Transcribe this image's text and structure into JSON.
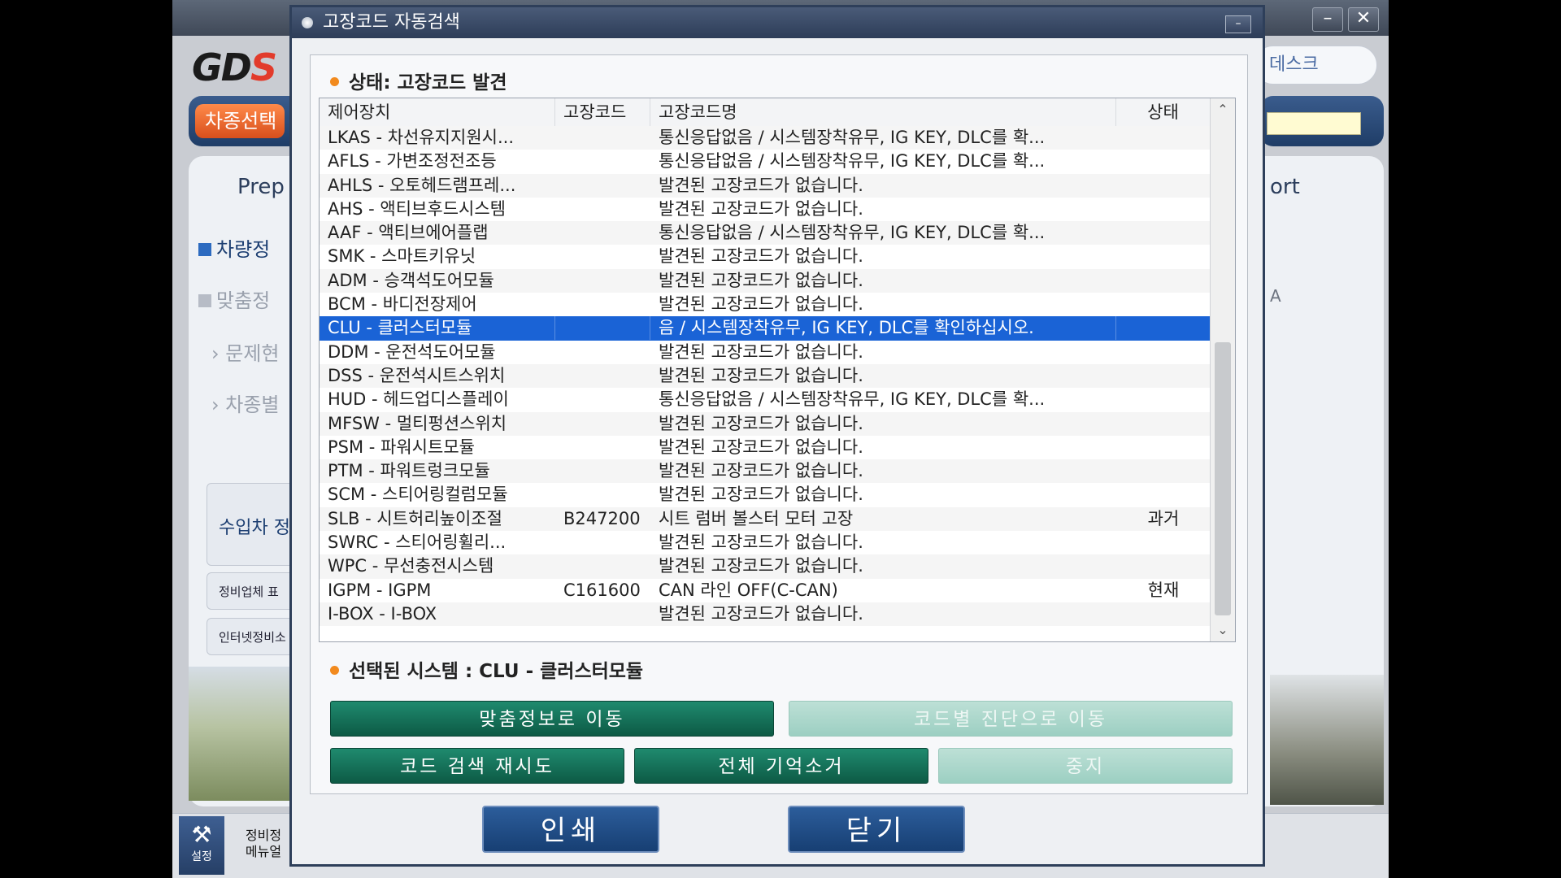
{
  "background_app": {
    "logo": "GDS",
    "nav_button": "차종선택",
    "right_pill": "데스크",
    "tab_left": "Prep",
    "tab_right": "ort",
    "side_items": [
      "차량정",
      "맞춤정",
      "문제현",
      "차종별"
    ],
    "box_label": "수입차 정",
    "small_box_1": "정비업체 표",
    "small_box_2": "인터넷정비소",
    "right_letter": "A",
    "bottom_settings": "설정",
    "bottom_menu": "정비정\n메뉴얼"
  },
  "dialog": {
    "title": "고장코드 자동검색",
    "min_button": "–",
    "status": "상태: 고장코드 발견",
    "columns": [
      "제어장치",
      "고장코드",
      "고장코드명",
      "상태"
    ],
    "rows": [
      {
        "system": "LKAS - 차선유지지원시...",
        "code": "",
        "name": "통신응답없음 / 시스템장착유무, IG KEY, DLC를 확...",
        "state": ""
      },
      {
        "system": "AFLS - 가변조정전조등",
        "code": "",
        "name": "통신응답없음 / 시스템장착유무, IG KEY, DLC를 확...",
        "state": ""
      },
      {
        "system": "AHLS - 오토헤드램프레...",
        "code": "",
        "name": "발견된 고장코드가 없습니다.",
        "state": ""
      },
      {
        "system": "AHS - 액티브후드시스템",
        "code": "",
        "name": "발견된 고장코드가 없습니다.",
        "state": ""
      },
      {
        "system": "AAF - 액티브에어플랩",
        "code": "",
        "name": "통신응답없음 / 시스템장착유무, IG KEY, DLC를 확...",
        "state": ""
      },
      {
        "system": "SMK - 스마트키유닛",
        "code": "",
        "name": "발견된 고장코드가 없습니다.",
        "state": ""
      },
      {
        "system": "ADM - 승객석도어모듈",
        "code": "",
        "name": "발견된 고장코드가 없습니다.",
        "state": ""
      },
      {
        "system": "BCM - 바디전장제어",
        "code": "",
        "name": "발견된 고장코드가 없습니다.",
        "state": ""
      },
      {
        "system": "CLU - 클러스터모듈",
        "code": "",
        "name": "음 / 시스템장착유무, IG KEY, DLC를 확인하십시오.",
        "state": ""
      },
      {
        "system": "DDM - 운전석도어모듈",
        "code": "",
        "name": "발견된 고장코드가 없습니다.",
        "state": ""
      },
      {
        "system": "DSS - 운전석시트스위치",
        "code": "",
        "name": "발견된 고장코드가 없습니다.",
        "state": ""
      },
      {
        "system": "HUD - 헤드업디스플레이",
        "code": "",
        "name": "통신응답없음 / 시스템장착유무, IG KEY, DLC를 확...",
        "state": ""
      },
      {
        "system": "MFSW - 멀티펑션스위치",
        "code": "",
        "name": "발견된 고장코드가 없습니다.",
        "state": ""
      },
      {
        "system": "PSM - 파워시트모듈",
        "code": "",
        "name": "발견된 고장코드가 없습니다.",
        "state": ""
      },
      {
        "system": "PTM - 파워트렁크모듈",
        "code": "",
        "name": "발견된 고장코드가 없습니다.",
        "state": ""
      },
      {
        "system": "SCM - 스티어링컬럼모듈",
        "code": "",
        "name": "발견된 고장코드가 없습니다.",
        "state": ""
      },
      {
        "system": "SLB - 시트허리높이조절",
        "code": "B247200",
        "name": "시트 럼버 볼스터 모터 고장",
        "state": "과거"
      },
      {
        "system": "SWRC - 스티어링휠리...",
        "code": "",
        "name": "발견된 고장코드가 없습니다.",
        "state": ""
      },
      {
        "system": "WPC - 무선충전시스템",
        "code": "",
        "name": "발견된 고장코드가 없습니다.",
        "state": ""
      },
      {
        "system": "IGPM - IGPM",
        "code": "C161600",
        "name": "CAN 라인 OFF(C-CAN)",
        "state": "현재"
      },
      {
        "system": "I-BOX - I-BOX",
        "code": "",
        "name": "발견된 고장코드가 없습니다.",
        "state": ""
      }
    ],
    "selected_row_index": 8,
    "selected_system": "선택된 시스템 :  CLU - 클러스터모듈",
    "buttons": {
      "goto_custom": "맞춤정보로 이동",
      "goto_code": "코드별 진단으로 이동",
      "retry": "코드 검색 재시도",
      "clear_all": "전체 기억소거",
      "stop": "중지"
    },
    "print": "인쇄",
    "close": "닫기"
  },
  "colors": {
    "selection": "#1a63d6",
    "button_green": "#0d5a45",
    "button_blue": "#1f4a82",
    "status_dot": "#f28a1e"
  }
}
